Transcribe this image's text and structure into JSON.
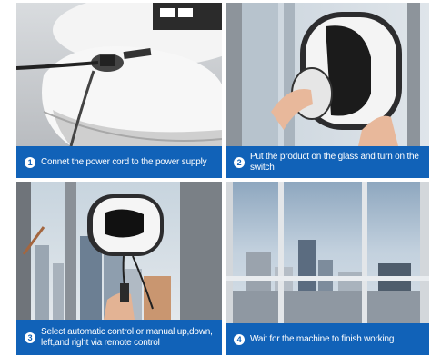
{
  "colors": {
    "caption_bg": "#1162b8",
    "number_text": "#1162b8"
  },
  "steps": [
    {
      "number": "1",
      "text": "Connet the power cord to the power supply",
      "image": "robot-plugged-in-photo"
    },
    {
      "number": "2",
      "text": "Put the product on the glass and turn on the switch",
      "image": "hands-placing-robot-photo"
    },
    {
      "number": "3",
      "text": "Select automatic control or manual up,down, left,and right via remote control",
      "image": "robot-on-window-photo"
    },
    {
      "number": "4",
      "text": "Wait for the machine to finish working",
      "image": "city-view-window-photo"
    }
  ]
}
